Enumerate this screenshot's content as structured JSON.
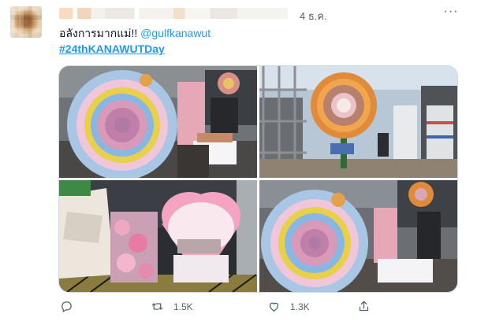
{
  "tweet": {
    "time": "4 ธ.ค.",
    "text_prefix": "อลังการมากแม่!! ",
    "mention": "@gulfkanawut",
    "hashtag": "#24thKANAWUTDay",
    "photos": [
      {
        "alt": "Round flower wreath with blue petals and pink center"
      },
      {
        "alt": "Large sunflower wreath standee on stage scaffolding"
      },
      {
        "alt": "Pink heart-shaped flower standee with roses"
      },
      {
        "alt": "Round flower wreath with sunflower ring"
      }
    ],
    "actions": {
      "reply_icon": "reply-icon",
      "retweet_count": "1.5K",
      "like_count": "1.3K",
      "share_icon": "share-icon"
    }
  },
  "colors": {
    "link": "#1d9bf0",
    "muted": "#536471",
    "border": "#cfd9de"
  }
}
